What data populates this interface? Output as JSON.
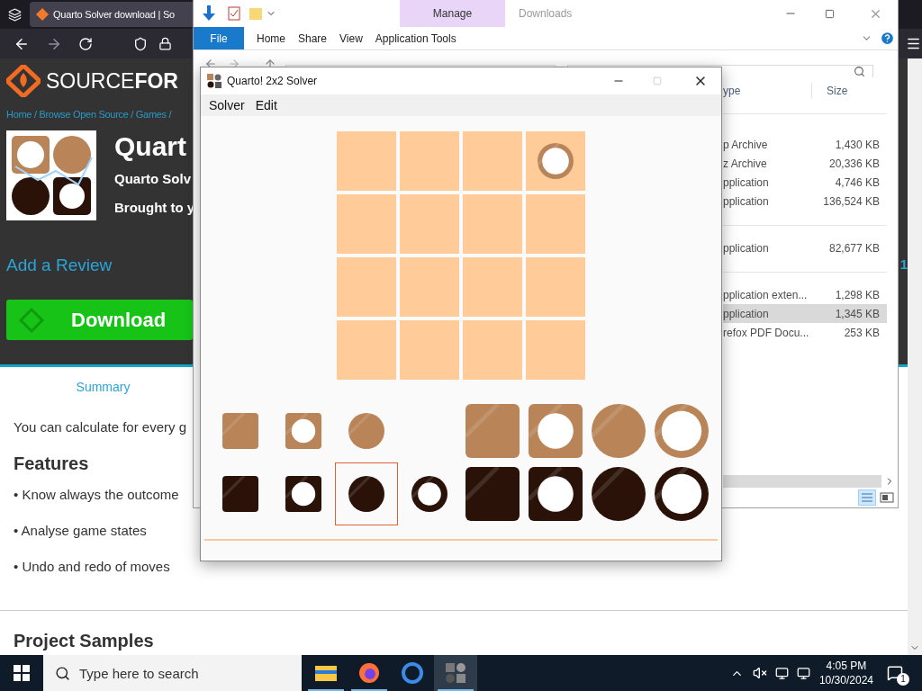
{
  "browser": {
    "tab": {
      "title": "Quarto Solver download | So"
    },
    "site": {
      "logo": "SOURCE**FOR**",
      "breadcrumb": "Home / Browse Open Source / Games /",
      "title": "Quart",
      "subtitle": "Quarto Solv",
      "byline": "Brought to y",
      "review_link": "Add a Review",
      "download_button": "Download",
      "side_mark": "1",
      "tab": "Summary",
      "description": "You can calculate for every g",
      "features_heading": "Features",
      "features": [
        "• Know always the outcome",
        "• Analyse game states",
        "• Undo and redo of moves"
      ],
      "samples_heading": "Project Samples"
    }
  },
  "explorer": {
    "title": "Downloads",
    "context_group": "Manage",
    "ribbon_tabs": [
      {
        "kind": "file",
        "label": "File"
      },
      {
        "kind": "tab",
        "label": "Home"
      },
      {
        "kind": "tab",
        "label": "Share"
      },
      {
        "kind": "tab",
        "label": "View"
      },
      {
        "kind": "context",
        "label": "Application Tools"
      }
    ],
    "columns": [
      "ype",
      "Size"
    ],
    "groups": [
      {
        "files": [
          {
            "type": "p Archive",
            "size": "1,430 KB",
            "selected": false
          },
          {
            "type": "z Archive",
            "size": "20,336 KB",
            "selected": false
          },
          {
            "type": "pplication",
            "size": "4,746 KB",
            "selected": false
          },
          {
            "type": "pplication",
            "size": "136,524 KB",
            "selected": false
          }
        ]
      },
      {
        "files": [
          {
            "type": "pplication",
            "size": "82,677 KB",
            "selected": false
          }
        ]
      },
      {
        "files": [
          {
            "type": "pplication exten...",
            "size": "1,298 KB",
            "selected": false
          },
          {
            "type": "pplication",
            "size": "1,345 KB",
            "selected": true
          },
          {
            "type": "refox PDF Docu...",
            "size": "253 KB",
            "selected": false
          }
        ]
      }
    ]
  },
  "solver": {
    "title": "Quarto! 2x2 Solver",
    "menu": [
      "Solver",
      "Edit"
    ],
    "board": [
      {
        "kind": "empty"
      },
      {
        "kind": "empty"
      },
      {
        "kind": "empty"
      },
      {
        "kind": "piece",
        "color": "#b98458",
        "round": true,
        "hollow": true,
        "large": false
      },
      {
        "kind": "empty"
      },
      {
        "kind": "empty"
      },
      {
        "kind": "empty"
      },
      {
        "kind": "empty"
      },
      {
        "kind": "empty"
      },
      {
        "kind": "empty"
      },
      {
        "kind": "empty"
      },
      {
        "kind": "empty"
      },
      {
        "kind": "empty"
      },
      {
        "kind": "empty"
      },
      {
        "kind": "empty"
      },
      {
        "kind": "empty"
      }
    ],
    "pool": [
      {
        "slots": [
          {
            "kind": "piece",
            "color": "#b98458",
            "round": false,
            "hollow": false,
            "large": false,
            "selected": false
          },
          {
            "kind": "piece",
            "color": "#b98458",
            "round": false,
            "hollow": true,
            "large": false,
            "selected": false
          },
          {
            "kind": "piece",
            "color": "#b98458",
            "round": true,
            "hollow": false,
            "large": false,
            "selected": false
          },
          {
            "kind": "empty"
          },
          {
            "kind": "piece",
            "color": "#b98458",
            "round": false,
            "hollow": false,
            "large": true,
            "selected": false
          },
          {
            "kind": "piece",
            "color": "#b98458",
            "round": false,
            "hollow": true,
            "large": true,
            "selected": false
          },
          {
            "kind": "piece",
            "color": "#b98458",
            "round": true,
            "hollow": false,
            "large": true,
            "selected": false
          },
          {
            "kind": "piece",
            "color": "#b98458",
            "round": true,
            "hollow": true,
            "large": true,
            "selected": false
          }
        ]
      },
      {
        "slots": [
          {
            "kind": "piece",
            "color": "#2a1209",
            "round": false,
            "hollow": false,
            "large": false,
            "selected": false
          },
          {
            "kind": "piece",
            "color": "#2a1209",
            "round": false,
            "hollow": true,
            "large": false,
            "selected": false
          },
          {
            "kind": "piece",
            "color": "#2a1209",
            "round": true,
            "hollow": false,
            "large": false,
            "selected": true
          },
          {
            "kind": "piece",
            "color": "#2a1209",
            "round": true,
            "hollow": true,
            "large": false,
            "selected": false
          },
          {
            "kind": "piece",
            "color": "#2a1209",
            "round": false,
            "hollow": false,
            "large": true,
            "selected": false
          },
          {
            "kind": "piece",
            "color": "#2a1209",
            "round": false,
            "hollow": true,
            "large": true,
            "selected": false
          },
          {
            "kind": "piece",
            "color": "#2a1209",
            "round": true,
            "hollow": false,
            "large": true,
            "selected": false
          },
          {
            "kind": "piece",
            "color": "#2a1209",
            "round": true,
            "hollow": true,
            "large": true,
            "selected": false
          }
        ]
      }
    ]
  },
  "taskbar": {
    "search": {
      "placeholder": "Type here to search"
    },
    "apps": [
      {
        "kind": "files",
        "running": true,
        "selected": false
      },
      {
        "kind": "firefox",
        "running": true,
        "selected": false
      },
      {
        "kind": "chrome",
        "running": false,
        "selected": false
      },
      {
        "kind": "solver",
        "running": true,
        "selected": true
      }
    ],
    "time": "4:05 PM",
    "date": "10/30/2024",
    "notifications": "1"
  }
}
